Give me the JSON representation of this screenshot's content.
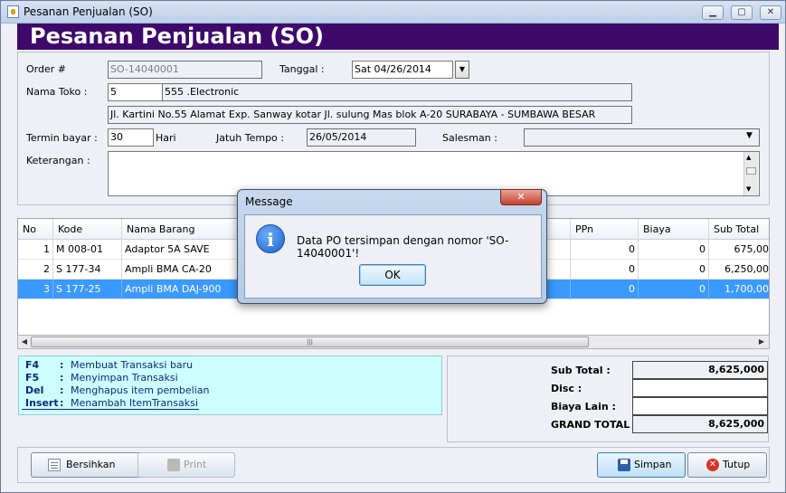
{
  "window": {
    "title": "Pesanan Penjualan (SO)",
    "min": "▁",
    "max": "▢",
    "close": "✕"
  },
  "header": {
    "banner": "Pesanan Penjualan (SO)"
  },
  "form": {
    "order_label": "Order #",
    "order_value": "SO-14040001",
    "tanggal_label": "Tanggal :",
    "tanggal_value": "Sat 04/26/2014",
    "nama_toko_label": "Nama Toko :",
    "toko_code": "5",
    "toko_name": "555 .Electronic",
    "toko_address": "Jl. Kartini No.55   Alamat Exp.  Sanway kotar  Jl. sulung Mas blok A-20  SURABAYA - SUMBAWA BESAR",
    "termin_label": "Termin bayar :",
    "termin_value": "30",
    "hari_label": "Hari",
    "jatuh_tempo_label": "Jatuh Tempo :",
    "jatuh_tempo_value": "26/05/2014",
    "salesman_label": "Salesman :",
    "salesman_value": "",
    "keterangan_label": "Keterangan :",
    "keterangan_value": ""
  },
  "table": {
    "columns": [
      "No",
      "Kode",
      "Nama Barang",
      "PPn",
      "Biaya",
      "Sub Total"
    ],
    "rows": [
      {
        "no": "1",
        "kode": "M 008-01",
        "nama": "Adaptor 5A SAVE",
        "ppn": "0",
        "biaya": "0",
        "subtotal": "675,00",
        "selected": false
      },
      {
        "no": "2",
        "kode": "S 177-34",
        "nama": "Ampli BMA CA-20",
        "ppn": "0",
        "biaya": "0",
        "subtotal": "6,250,00",
        "selected": false
      },
      {
        "no": "3",
        "kode": "S 177-25",
        "nama": "Ampli BMA DAJ-900",
        "ppn": "0",
        "biaya": "0",
        "subtotal": "1,700,00",
        "selected": true
      }
    ]
  },
  "hints": [
    {
      "key": "F4",
      "colon": ":",
      "desc": "Membuat Transaksi baru"
    },
    {
      "key": "F5",
      "colon": ":",
      "desc": "Menyimpan Transaksi"
    },
    {
      "key": "Del",
      "colon": ":",
      "desc": "Menghapus item pembelian"
    },
    {
      "key": "Insert",
      "colon": ":",
      "desc": "Menambah ItemTransaksi"
    }
  ],
  "totals": {
    "sub_total_label": "Sub Total :",
    "sub_total_value": "8,625,000",
    "disc_label": "Disc :",
    "disc_value": "",
    "biaya_lain_label": "Biaya Lain :",
    "biaya_lain_value": "",
    "grand_total_label": "GRAND TOTAL :",
    "grand_total_value": "8,625,000"
  },
  "buttons": {
    "bersihkan": "Bersihkan",
    "print": "Print",
    "simpan": "Simpan",
    "tutup": "Tutup"
  },
  "dialog": {
    "title": "Message",
    "close": "✕",
    "icon": "i",
    "message": "Data PO tersimpan dengan nomor 'SO-14040001'!",
    "ok": "OK"
  },
  "colors": {
    "banner": "#3d0a6c",
    "selection": "#3a99fc",
    "hint_bg": "#ccfefe"
  }
}
